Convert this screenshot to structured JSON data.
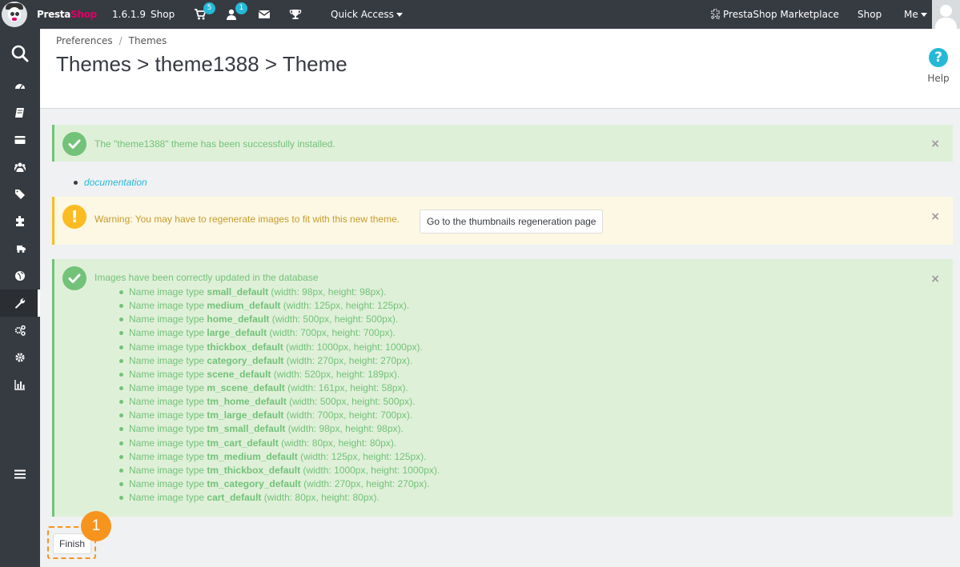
{
  "topbar": {
    "brand_1": "Presta",
    "brand_2": "Shop",
    "version": "1.6.1.9",
    "shop_label": "Shop",
    "orders_badge": "5",
    "customers_badge": "1",
    "quick_access": "Quick Access",
    "marketplace": "PrestaShop Marketplace",
    "shop_link": "Shop",
    "me": "Me"
  },
  "sidebar": {
    "items": [
      {
        "icon": "search-icon"
      },
      {
        "icon": "dashboard-icon"
      },
      {
        "icon": "catalog-icon"
      },
      {
        "icon": "orders-icon"
      },
      {
        "icon": "customers-icon"
      },
      {
        "icon": "price-rules-icon"
      },
      {
        "icon": "modules-icon"
      },
      {
        "icon": "shipping-icon"
      },
      {
        "icon": "localization-icon"
      },
      {
        "icon": "preferences-icon",
        "active": true
      },
      {
        "icon": "advanced-parameters-icon"
      },
      {
        "icon": "administration-icon"
      },
      {
        "icon": "stats-icon"
      },
      {
        "icon": "collapse-menu-icon"
      }
    ]
  },
  "header": {
    "breadcrumb": [
      "Preferences",
      "Themes"
    ],
    "title": "Themes > theme1388 > Theme",
    "help": "Help"
  },
  "alerts": {
    "success_install": "The \"theme1388\" theme has been successfully installed.",
    "documentation_link": "documentation",
    "warning": "Warning: You may have to regenerate images to fit with this new theme.",
    "thumbnails_button": "Go to the thumbnails regeneration page",
    "images_updated": "Images have been correctly updated in the database",
    "close_symbol": "×"
  },
  "image_types": [
    {
      "prefix": "Name image type ",
      "name": "small_default",
      "dims": " (width: 98px, height: 98px)."
    },
    {
      "prefix": "Name image type ",
      "name": "medium_default",
      "dims": " (width: 125px, height: 125px)."
    },
    {
      "prefix": "Name image type ",
      "name": "home_default",
      "dims": " (width: 500px, height: 500px)."
    },
    {
      "prefix": "Name image type ",
      "name": "large_default",
      "dims": " (width: 700px, height: 700px)."
    },
    {
      "prefix": "Name image type ",
      "name": "thickbox_default",
      "dims": " (width: 1000px, height: 1000px)."
    },
    {
      "prefix": "Name image type ",
      "name": "category_default",
      "dims": " (width: 270px, height: 270px)."
    },
    {
      "prefix": "Name image type ",
      "name": "scene_default",
      "dims": " (width: 520px, height: 189px)."
    },
    {
      "prefix": "Name image type ",
      "name": "m_scene_default",
      "dims": " (width: 161px, height: 58px)."
    },
    {
      "prefix": "Name image type ",
      "name": "tm_home_default",
      "dims": " (width: 500px, height: 500px)."
    },
    {
      "prefix": "Name image type ",
      "name": "tm_large_default",
      "dims": " (width: 700px, height: 700px)."
    },
    {
      "prefix": "Name image type ",
      "name": "tm_small_default",
      "dims": " (width: 98px, height: 98px)."
    },
    {
      "prefix": "Name image type ",
      "name": "tm_cart_default",
      "dims": " (width: 80px, height: 80px)."
    },
    {
      "prefix": "Name image type ",
      "name": "tm_medium_default",
      "dims": " (width: 125px, height: 125px)."
    },
    {
      "prefix": "Name image type ",
      "name": "tm_thickbox_default",
      "dims": " (width: 1000px, height: 1000px)."
    },
    {
      "prefix": "Name image type ",
      "name": "tm_category_default",
      "dims": " (width: 270px, height: 270px)."
    },
    {
      "prefix": "Name image type ",
      "name": "cart_default",
      "dims": " (width: 80px, height: 80px)."
    }
  ],
  "finish_button": "Finish",
  "step_marker": "1",
  "colors": {
    "topbar": "#363a41",
    "accent": "#25b9d7",
    "success": "#72c279",
    "warning": "#fbbb22",
    "marker": "#f7941d",
    "brand_pink": "#df0067"
  }
}
